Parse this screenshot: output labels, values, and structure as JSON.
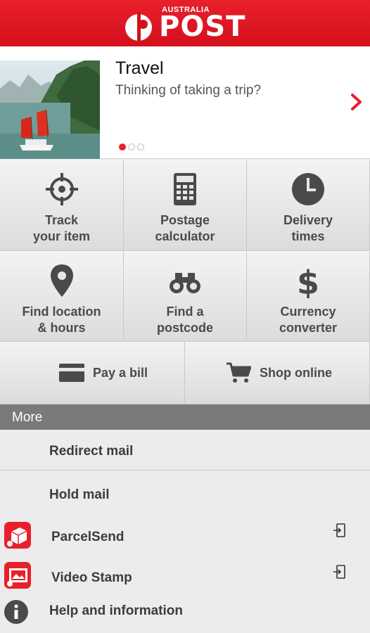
{
  "header": {
    "logo_country": "AUSTRALIA",
    "logo_word": "POST",
    "brand_color": "#e8202c"
  },
  "banner": {
    "title": "Travel",
    "subtitle": "Thinking of taking a trip?",
    "slide_count": 3,
    "active_slide": 1
  },
  "tiles": [
    {
      "line1": "Track",
      "line2": "your item",
      "icon": "crosshair-icon"
    },
    {
      "line1": "Postage",
      "line2": "calculator",
      "icon": "calculator-icon"
    },
    {
      "line1": "Delivery",
      "line2": "times",
      "icon": "clock-icon"
    },
    {
      "line1": "Find location",
      "line2": "& hours",
      "icon": "location-pin-icon"
    },
    {
      "line1": "Find a",
      "line2": "postcode",
      "icon": "binoculars-icon"
    },
    {
      "line1": "Currency",
      "line2": "converter",
      "icon": "dollar-icon"
    }
  ],
  "wide": [
    {
      "label": "Pay a bill",
      "icon": "card-icon"
    },
    {
      "label": "Shop online",
      "icon": "cart-icon"
    }
  ],
  "more": {
    "header": "More",
    "items": [
      {
        "label": "Redirect mail"
      },
      {
        "label": "Hold mail"
      },
      {
        "label": "ParcelSend",
        "icon": "parcelsend-app-icon",
        "external": true
      },
      {
        "label": "Video Stamp",
        "icon": "videostamp-app-icon",
        "external": true
      },
      {
        "label": "Help and information",
        "icon": "info-icon"
      }
    ]
  }
}
